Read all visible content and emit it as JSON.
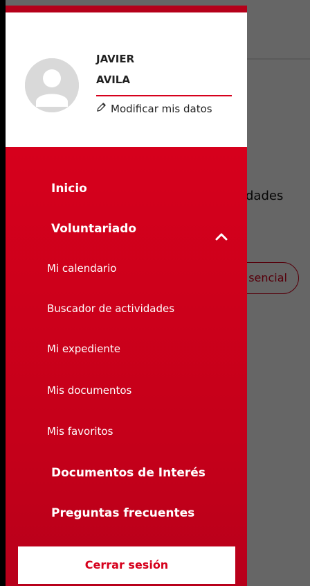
{
  "background_page": {
    "title_fragment": ")",
    "subtitle_fragment": "idades",
    "chip_fragment": "sencial"
  },
  "drawer": {
    "user": {
      "first_name": "JAVIER",
      "last_name": "AVILA",
      "edit_label": "Modificar mis datos"
    },
    "menu": {
      "inicio": "Inicio",
      "voluntariado": "Voluntariado",
      "sub_items": [
        "Mi calendario",
        "Buscador de actividades",
        "Mi expediente",
        "Mis documentos",
        "Mis favoritos"
      ],
      "documentos_interes": "Documentos de Interés",
      "preguntas_frecuentes": "Preguntas frecuentes"
    },
    "logout_label": "Cerrar sesión"
  },
  "colors": {
    "brand_red": "#d6001c",
    "overlay": "rgba(0,0,0,0.6)"
  },
  "icons": {
    "avatar": "user-avatar-icon",
    "edit": "pencil-icon",
    "chevron": "chevron-up-icon"
  }
}
